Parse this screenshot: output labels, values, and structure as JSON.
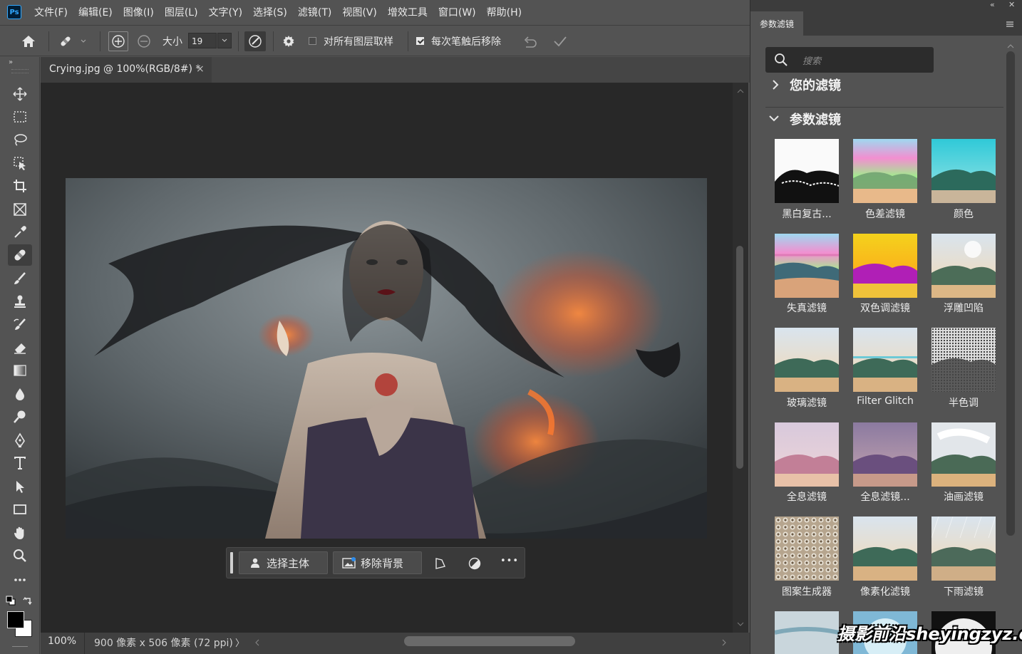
{
  "app": {
    "logo": "Ps"
  },
  "menu": [
    "文件(F)",
    "编辑(E)",
    "图像(I)",
    "图层(L)",
    "文字(Y)",
    "选择(S)",
    "滤镜(T)",
    "视图(V)",
    "增效工具",
    "窗口(W)",
    "帮助(H)"
  ],
  "options": {
    "size_label": "大小",
    "size_value": "19",
    "sample_all_layers": "对所有图层取样",
    "remove_after_stroke": "每次笔触后移除",
    "sample_all_checked": false,
    "remove_after_checked": true
  },
  "document": {
    "tab_title": "Crying.jpg @ 100%(RGB/8#) *",
    "close_glyph": "×",
    "zoom": "100%",
    "info": "900 像素 x 506 像素 (72 ppi)",
    "info_arrow": "〉"
  },
  "taskbar": {
    "select_subject": "选择主体",
    "remove_background": "移除背景",
    "more": "•••"
  },
  "panel": {
    "tab": "参数滤镜",
    "search_placeholder": "搜索",
    "your_filters": "您的滤镜",
    "neural_filters": "参数滤镜",
    "collapse_glyph": "«",
    "close_glyph": "✕",
    "filters": [
      {
        "label": "黑白复古..."
      },
      {
        "label": "色差滤镜"
      },
      {
        "label": "颜色"
      },
      {
        "label": "失真滤镜"
      },
      {
        "label": "双色调滤镜"
      },
      {
        "label": "浮雕凹陷"
      },
      {
        "label": "玻璃滤镜"
      },
      {
        "label": "Filter Glitch"
      },
      {
        "label": "半色调"
      },
      {
        "label": "全息滤镜"
      },
      {
        "label": "全息滤镜..."
      },
      {
        "label": "油画滤镜"
      },
      {
        "label": "图案生成器"
      },
      {
        "label": "像素化滤镜"
      },
      {
        "label": "下雨滤镜"
      }
    ]
  },
  "watermark": "摄影前沿sheyingzyz.com"
}
